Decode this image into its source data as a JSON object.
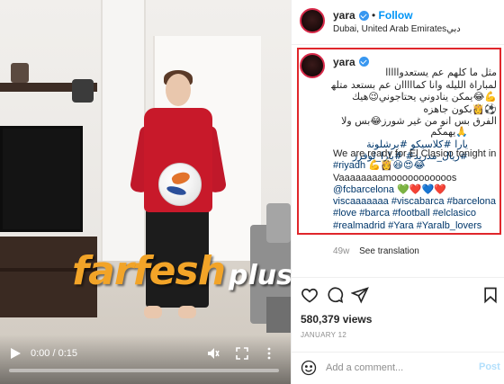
{
  "video": {
    "time": "0:00 / 0:15",
    "progress": 0,
    "watermark_main": "farfesh",
    "watermark_sub": "plus.com"
  },
  "post": {
    "username": "yara",
    "follow_label": "Follow",
    "location": "Dubai, United Arab Emiratesدبي",
    "caption": {
      "username": "yara",
      "arabic_lines": [
        "مثل ما كلهم عم يستعدوااااا",
        "لمباراة الليله وانا كمااااان عم بستعد متلهم",
        "💪😂يمكن ينادوني يحتاجوني😉هيك",
        "⚽👸بكون جاهزه",
        "الفرق بس انو من غير شورز😂بس ولا",
        "🙏يهمكم"
      ],
      "arabic_tags": "يارا #كلاسيكو #برشلونة #ريال_مدريد# #يارا_لوفرز",
      "english_lines": [
        "We are ready for El Clasico tonight in",
        "#riyadh 💪👸😆😍😂",
        "Vaaaaaaaamooooooooooos",
        "@fcbarcelona 💚❤️💙❤️",
        "viscaaaaaaa #viscabarca #barcelona",
        "#love #barca #football #elclasico",
        "#realmadrid #Yara #Yaralb_lovers"
      ]
    },
    "age": "49w",
    "see_translation": "See translation",
    "views": "580,379 views",
    "date": "JANUARY 12",
    "comment_placeholder": "Add a comment...",
    "post_label": "Post"
  },
  "colors": {
    "follow": "#0095f6",
    "verified": "#3897f0",
    "highlight_border": "#e0262b",
    "hashtag": "#00376b",
    "post_disabled": "#b2dffc"
  },
  "icons": [
    "play-icon",
    "mute-icon",
    "fullscreen-icon",
    "more-icon",
    "heart-icon",
    "comment-icon",
    "share-icon",
    "bookmark-icon",
    "emoji-icon",
    "verified-icon"
  ]
}
